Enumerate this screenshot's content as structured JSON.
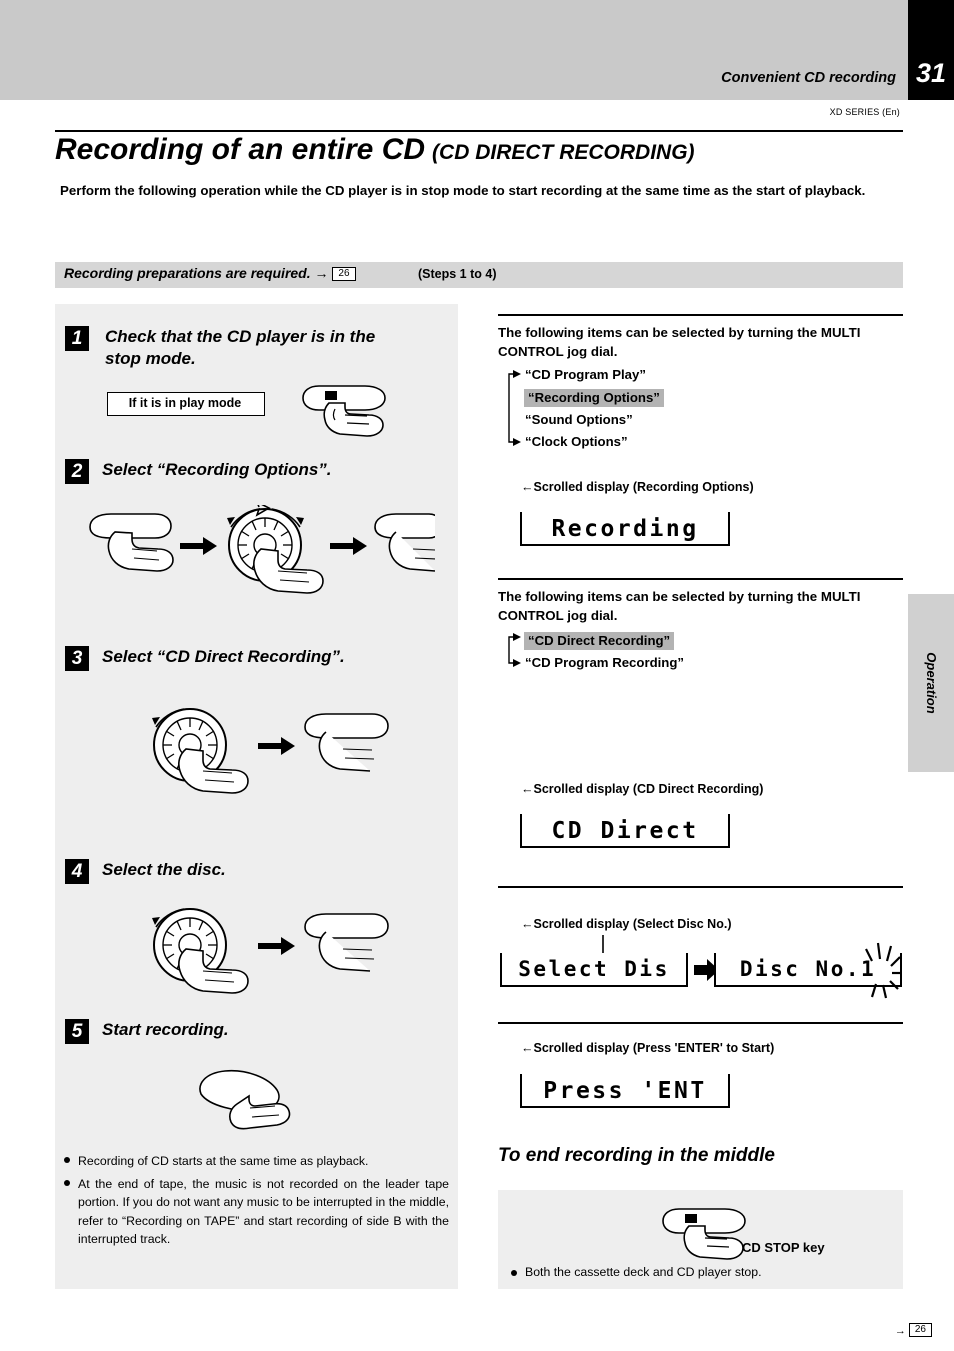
{
  "header": {
    "running_title": "Convenient CD recording",
    "page_number": "31",
    "series": "XD SERIES (En)"
  },
  "title": {
    "main": "Recording of an entire CD",
    "sub": "(CD DIRECT RECORDING)"
  },
  "intro": "Perform the following operation while the CD player is in stop mode to start recording at the same time as the start of playback.",
  "prep": {
    "text": "Recording preparations are required.",
    "arrow": "→",
    "page_ref": "26",
    "steps": "(Steps 1 to 4)"
  },
  "steps": [
    {
      "num": "1",
      "title": "Check that the CD player is in the\nstop mode."
    },
    {
      "num": "2",
      "title": "Select “Recording Options”."
    },
    {
      "num": "3",
      "title": "Select  “CD Direct Recording”."
    },
    {
      "num": "4",
      "title": "Select the disc."
    },
    {
      "num": "5",
      "title": "Start recording."
    }
  ],
  "play_mode_callout": "If it is in play mode",
  "left_notes": [
    "Recording of CD starts at the same time as playback.",
    "At the end of tape, the music is not recorded on the leader tape portion. If you do not want any music to be interrupted in the middle, refer to “Recording on TAPE” and start recording of side B with the interrupted track."
  ],
  "left_ref": {
    "arrow": "→",
    "page": "26"
  },
  "right": {
    "block1": {
      "heading": "The following items can be selected by turning the MULTI CONTROL jog dial.",
      "items": [
        {
          "label": "“CD Program Play”",
          "highlighted": false
        },
        {
          "label": "“Recording Options”",
          "highlighted": true
        },
        {
          "label": "“Sound Options”",
          "highlighted": false
        },
        {
          "label": "“Clock Options”",
          "highlighted": false
        }
      ],
      "scrolled_caption": "←Scrolled display (Recording Options)",
      "display": "Recording"
    },
    "block2": {
      "heading": "The following items can be selected by turning the MULTI CONTROL jog dial.",
      "items": [
        {
          "label": "“CD Direct Recording”",
          "highlighted": true
        },
        {
          "label": "“CD Program Recording”",
          "highlighted": false
        }
      ],
      "scrolled_caption": "←Scrolled display (CD Direct Recording)",
      "display": "CD Direct"
    },
    "block3": {
      "scrolled_caption": "←Scrolled display (Select Disc No.)",
      "display_left": "Select Dis",
      "display_right": "Disc No.1"
    },
    "block4": {
      "scrolled_caption": "←Scrolled display (Press 'ENTER' to Start)",
      "display": "Press 'ENT"
    }
  },
  "end_section": {
    "title": "To end recording in the middle",
    "key_label": "CD STOP key",
    "note": "Both the cassette deck and CD player stop."
  },
  "side_tab": {
    "label": "Operation"
  },
  "colors": {
    "header_band": "#c9c9c9",
    "panel": "#eeeeee",
    "highlight": "#b3b3b3",
    "page_box": "#000000"
  }
}
